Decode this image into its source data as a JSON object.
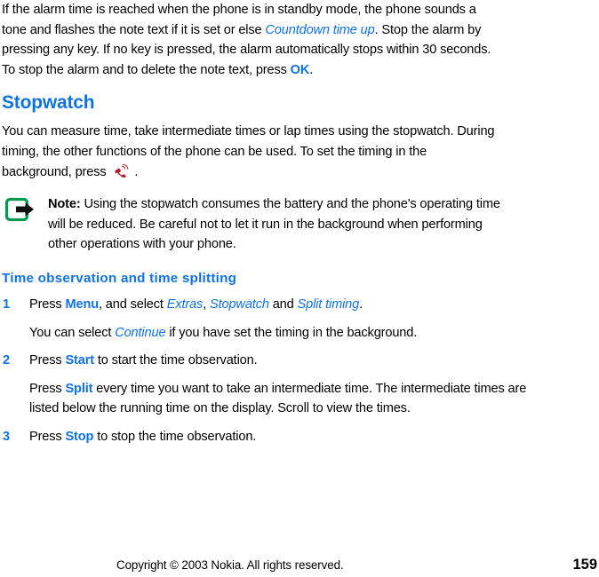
{
  "document": {
    "type": "user-guide-page",
    "colors": {
      "link_blue": "#1072e0",
      "note_icon_green": "#009a4e",
      "phone_icon_red": "#b01c29",
      "text_black": "#000000",
      "background": "#ffffff"
    }
  },
  "intro_paragraph": {
    "part1": "If the alarm time is reached when the phone is in standby mode, the phone sounds a tone and flashes the note text if it is set or else ",
    "emphasis1": "Countdown time up",
    "part2": ". Stop the alarm by pressing any key. If no key is pressed, the alarm automatically stops within 30 seconds. To stop the alarm and to delete the note text, press ",
    "emphasis2": "OK",
    "part3": "."
  },
  "stopwatch_section": {
    "heading": "Stopwatch",
    "paragraph_part1": "You can measure time, take intermediate times or lap times using the stopwatch. During timing, the other functions of the phone can be used. To set the timing in the background, press ",
    "icon_name": "call-key-icon",
    "paragraph_part2": "."
  },
  "note": {
    "icon_name": "note-arrow-icon",
    "label": "Note:",
    "text": " Using the stopwatch consumes the battery and the phone's operating time will be reduced. Be careful not to let it run in the background when performing other operations with your phone."
  },
  "time_observation": {
    "heading": "Time observation and time splitting",
    "steps": [
      {
        "number": "1",
        "text_part1": "Press ",
        "key1": "Menu",
        "text_part2": ", and select ",
        "key2": "Extras",
        "text_part3": ", ",
        "key3": "Stopwatch",
        "text_part4": " and ",
        "key4": "Split timing",
        "text_part5": "."
      },
      {
        "number": "2",
        "text_part1": "Press ",
        "key1": "Start",
        "text_part2": " to start the time observation."
      },
      {
        "number": "3",
        "text_part1": "Press ",
        "key1": "Stop",
        "text_part2": " to stop the time observation."
      }
    ],
    "note_after_step1_part1": "You can select ",
    "note_after_step1_key": "Continue",
    "note_after_step1_part2": " if you have set the timing in the background.",
    "note_after_step2_part1": "Press ",
    "note_after_step2_key": "Split",
    "note_after_step2_part2": " every time you want to take an intermediate time. The intermediate times are listed below the running time on the display. Scroll to view the times."
  },
  "footer": {
    "copyright": "Copyright © 2003 Nokia. All rights reserved.",
    "page_number": "159"
  }
}
